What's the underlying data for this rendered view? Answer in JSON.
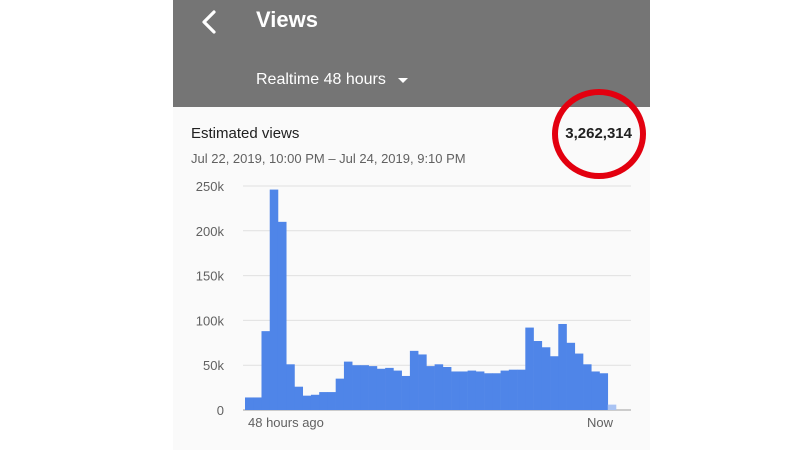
{
  "header": {
    "title": "Views",
    "range_label": "Realtime 48 hours",
    "back_icon": "chevron-left-icon",
    "dropdown_icon": "caret-down-icon"
  },
  "card": {
    "metric_label": "Estimated views",
    "date_range": "Jul 22, 2019, 10:00 PM – Jul 24, 2019, 9:10 PM",
    "total": "3,262,314"
  },
  "colors": {
    "app_bar": "#757575",
    "bar": "#4f85e8",
    "bar_current": "#a9c3f3",
    "annotation": "#e3000f"
  },
  "chart_data": {
    "type": "bar",
    "x_start_label": "48 hours ago",
    "x_end_label": "Now",
    "y_ticks": [
      "0",
      "50k",
      "100k",
      "150k",
      "200k",
      "250k"
    ],
    "y_tick_values": [
      0,
      50000,
      100000,
      150000,
      200000,
      250000
    ],
    "ylim": [
      0,
      250000
    ],
    "grid": true,
    "values": [
      14000,
      14000,
      88000,
      246000,
      210000,
      51000,
      26000,
      16000,
      17000,
      20000,
      20000,
      35000,
      54000,
      50000,
      50000,
      49000,
      46000,
      47000,
      44000,
      38000,
      66000,
      62000,
      49000,
      51000,
      48000,
      43000,
      43000,
      44000,
      43000,
      41000,
      41000,
      44000,
      45000,
      45000,
      92000,
      77000,
      70000,
      60000,
      96000,
      75000,
      63000,
      51000,
      43000,
      41000,
      6000
    ],
    "current_bar_index": 44
  }
}
